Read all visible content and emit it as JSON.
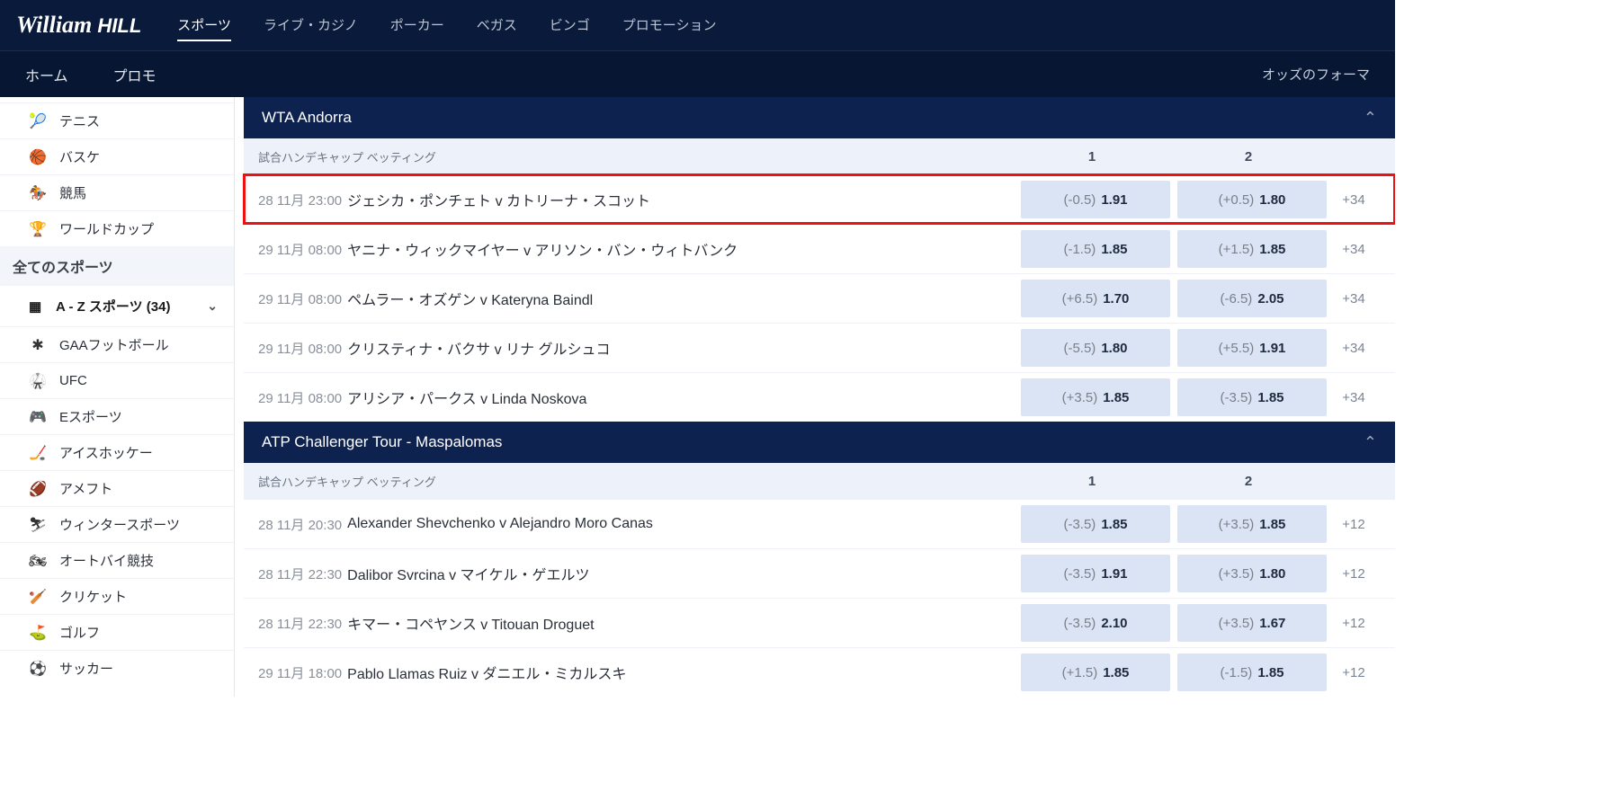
{
  "logo": {
    "script": "William",
    "block": "HILL"
  },
  "topnav": [
    {
      "label": "スポーツ",
      "active": true
    },
    {
      "label": "ライブ・カジノ"
    },
    {
      "label": "ポーカー"
    },
    {
      "label": "ベガス"
    },
    {
      "label": "ビンゴ"
    },
    {
      "label": "プロモーション"
    }
  ],
  "subnav": {
    "left": [
      {
        "label": "ホーム"
      },
      {
        "label": "プロモ"
      }
    ],
    "right": "オッズのフォーマ"
  },
  "sidebar": {
    "top": [
      {
        "icon": "🎾",
        "label": "テニス"
      },
      {
        "icon": "🏀",
        "label": "バスケ"
      },
      {
        "icon": "🏇",
        "label": "競馬"
      },
      {
        "icon": "🏆",
        "label": "ワールドカップ"
      }
    ],
    "header": "全てのスポーツ",
    "az": {
      "icon": "▦",
      "label": "A - Z スポーツ (34)",
      "chev": "⌄"
    },
    "list": [
      {
        "icon": "✱",
        "label": "GAAフットボール"
      },
      {
        "icon": "🥋",
        "label": "UFC"
      },
      {
        "icon": "🎮",
        "label": "Eスポーツ"
      },
      {
        "icon": "🏒",
        "label": "アイスホッケー"
      },
      {
        "icon": "🏈",
        "label": "アメフト"
      },
      {
        "icon": "⛷",
        "label": "ウィンタースポーツ"
      },
      {
        "icon": "🏍",
        "label": "オートバイ競技"
      },
      {
        "icon": "🏏",
        "label": "クリケット"
      },
      {
        "icon": "⛳",
        "label": "ゴルフ"
      },
      {
        "icon": "⚽",
        "label": "サッカー"
      }
    ]
  },
  "betLabel": "試合ハンデキャップ ベッティング",
  "colHeads": [
    "1",
    "2"
  ],
  "sections": [
    {
      "title": "WTA Andorra",
      "matches": [
        {
          "dt": "28 11月 23:00",
          "name": "ジェシカ・ポンチェト v カトリーナ・スコット",
          "o1h": "(-0.5)",
          "o1v": "1.91",
          "o2h": "(+0.5)",
          "o2v": "1.80",
          "more": "+34",
          "hl": true
        },
        {
          "dt": "29 11月 08:00",
          "name": "ヤニナ・ウィックマイヤー v アリソン・バン・ウィトバンク",
          "o1h": "(-1.5)",
          "o1v": "1.85",
          "o2h": "(+1.5)",
          "o2v": "1.85",
          "more": "+34"
        },
        {
          "dt": "29 11月 08:00",
          "name": "ペムラー・オズゲン v Kateryna Baindl",
          "o1h": "(+6.5)",
          "o1v": "1.70",
          "o2h": "(-6.5)",
          "o2v": "2.05",
          "more": "+34"
        },
        {
          "dt": "29 11月 08:00",
          "name": "クリスティナ・バクサ v リナ グルシュコ",
          "o1h": "(-5.5)",
          "o1v": "1.80",
          "o2h": "(+5.5)",
          "o2v": "1.91",
          "more": "+34"
        },
        {
          "dt": "29 11月 08:00",
          "name": "アリシア・パークス v Linda Noskova",
          "o1h": "(+3.5)",
          "o1v": "1.85",
          "o2h": "(-3.5)",
          "o2v": "1.85",
          "more": "+34"
        }
      ]
    },
    {
      "title": "ATP Challenger Tour - Maspalomas",
      "matches": [
        {
          "dt": "28 11月 20:30",
          "name": "Alexander Shevchenko v Alejandro Moro Canas",
          "o1h": "(-3.5)",
          "o1v": "1.85",
          "o2h": "(+3.5)",
          "o2v": "1.85",
          "more": "+12"
        },
        {
          "dt": "28 11月 22:30",
          "name": "Dalibor Svrcina v マイケル・ゲエルツ",
          "o1h": "(-3.5)",
          "o1v": "1.91",
          "o2h": "(+3.5)",
          "o2v": "1.80",
          "more": "+12"
        },
        {
          "dt": "28 11月 22:30",
          "name": "キマー・コペヤンス v Titouan Droguet",
          "o1h": "(-3.5)",
          "o1v": "2.10",
          "o2h": "(+3.5)",
          "o2v": "1.67",
          "more": "+12"
        },
        {
          "dt": "29 11月 18:00",
          "name": "Pablo Llamas Ruiz v ダニエル・ミカルスキ",
          "o1h": "(+1.5)",
          "o1v": "1.85",
          "o2h": "(-1.5)",
          "o2v": "1.85",
          "more": "+12"
        }
      ]
    }
  ]
}
